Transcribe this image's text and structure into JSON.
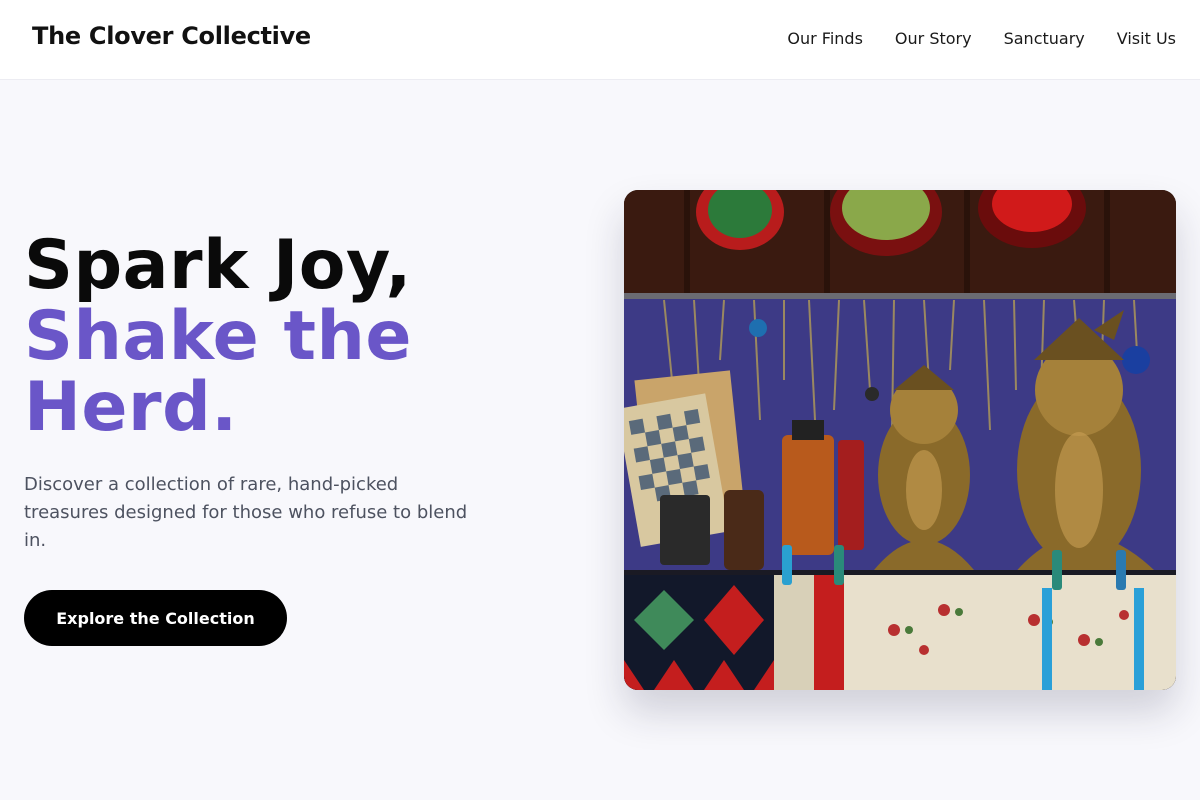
{
  "header": {
    "brand": "The Clover Collective",
    "nav": [
      "Our Finds",
      "Our Story",
      "Sanctuary",
      "Visit Us"
    ]
  },
  "hero": {
    "headline_line1": "Spark Joy,",
    "headline_line2": "Shake the Herd.",
    "description": "Discover a collection of rare, hand-picked treasures designed for those who refuse to blend in.",
    "cta_label": "Explore the Collection",
    "image_alt": "Market stall with brass busts, chessboards, necklaces and embroidered textiles"
  },
  "colors": {
    "accent": "#6a56c8",
    "cta_bg": "#000000",
    "page_bg": "#f8f8fc"
  }
}
